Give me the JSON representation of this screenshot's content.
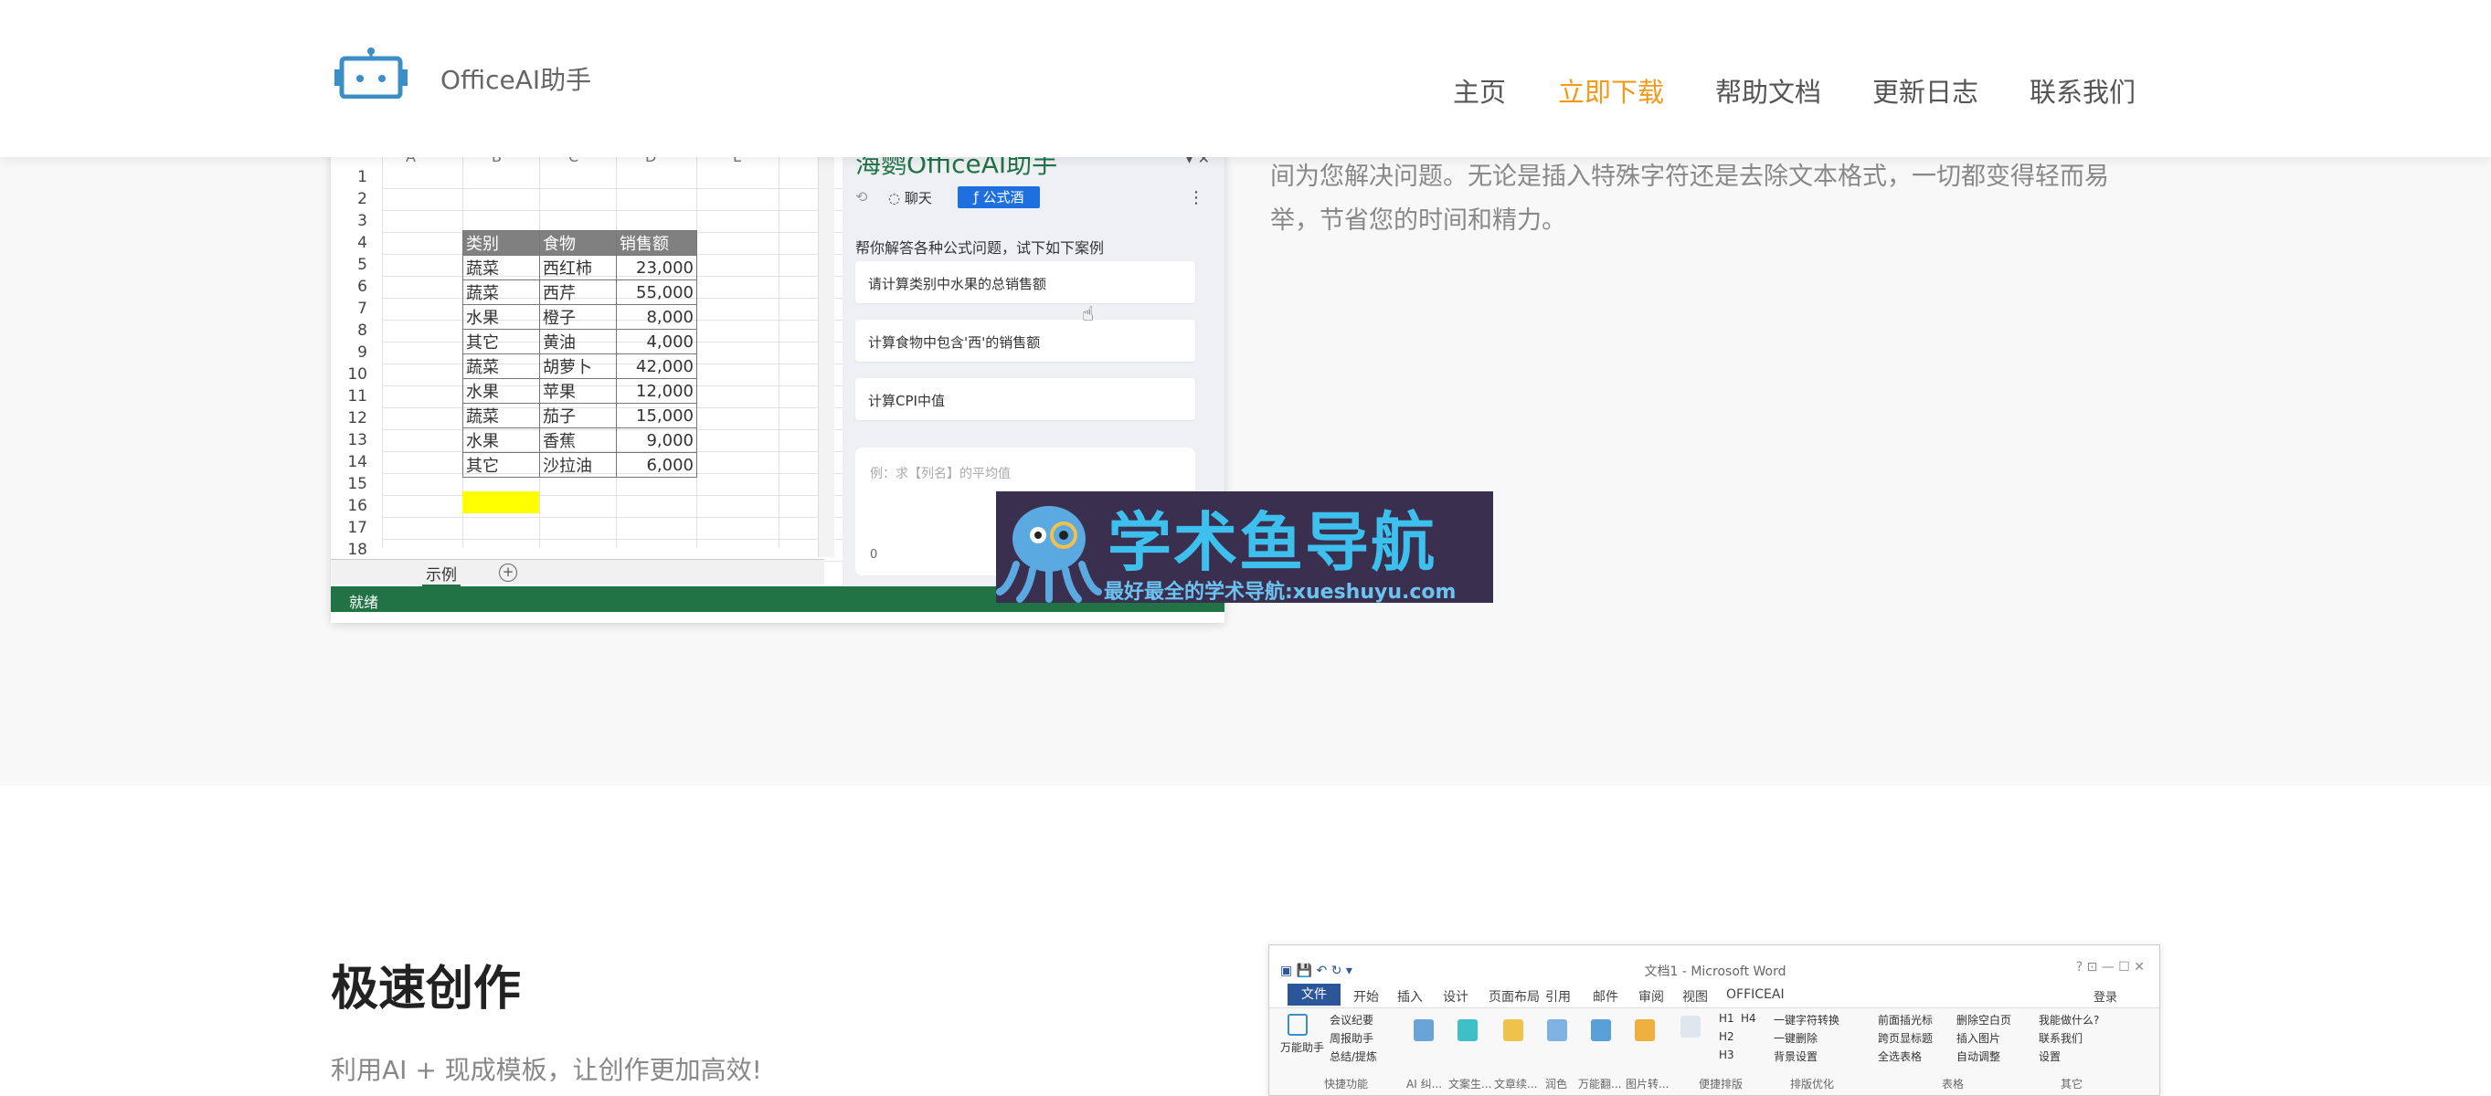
{
  "header": {
    "brand": "OfficeAI助手",
    "nav": [
      {
        "label": "主页"
      },
      {
        "label": "立即下载"
      },
      {
        "label": "帮助文档"
      },
      {
        "label": "更新日志"
      },
      {
        "label": "联系我们"
      }
    ],
    "active_color": "#f39a1a"
  },
  "hero": {
    "text": "间为您解决问题。无论是插入特殊字符还是去除文本格式，一切都变得轻而易举，节省您的时间和精力。"
  },
  "excel": {
    "columns": [
      "A",
      "B",
      "C",
      "D",
      "E"
    ],
    "rows": [
      "1",
      "2",
      "3",
      "4",
      "5",
      "6",
      "7",
      "8",
      "9",
      "10",
      "11",
      "12",
      "13",
      "14",
      "15",
      "16",
      "17",
      "18"
    ],
    "table_headers": [
      "类别",
      "食物",
      "销售额"
    ],
    "table_rows": [
      [
        "蔬菜",
        "西红柿",
        "23,000"
      ],
      [
        "蔬菜",
        "西芹",
        "55,000"
      ],
      [
        "水果",
        "橙子",
        "8,000"
      ],
      [
        "其它",
        "黄油",
        "4,000"
      ],
      [
        "蔬菜",
        "胡萝卜",
        "42,000"
      ],
      [
        "水果",
        "苹果",
        "12,000"
      ],
      [
        "蔬菜",
        "茄子",
        "15,000"
      ],
      [
        "水果",
        "香蕉",
        "9,000"
      ],
      [
        "其它",
        "沙拉油",
        "6,000"
      ]
    ],
    "sheet_tab": "示例",
    "status": "就绪",
    "status_color": "#217346"
  },
  "panel": {
    "title": "海鹦OfficeAI助手",
    "controls": "▾  ✕",
    "tab_chat": "聊天",
    "tab_formula": "公式酒",
    "hint": "帮你解答各种公式问题，试下如下案例",
    "cases": [
      "请计算类别中水果的总销售额",
      "计算食物中包含'西'的销售额",
      "计算CPI中值"
    ],
    "input_placeholder": "例：求【列名】的平均值",
    "input_count": "0",
    "accent": "#1e6fdf"
  },
  "watermark": {
    "title": "学术鱼导航",
    "subtitle": "最好最全的学术导航:xueshuyu.com"
  },
  "section2": {
    "title": "极速创作",
    "subtitle": "利用AI + 现成模板，让创作更加高效!"
  },
  "word": {
    "title": "文档1 - Microsoft Word",
    "window_controls": "?  ⊡  —  ☐  ✕",
    "file_tab": "文件",
    "tabs": [
      "开始",
      "插入",
      "设计",
      "页面布局",
      "引用",
      "邮件",
      "审阅",
      "视图",
      "OFFICEAI"
    ],
    "login": "登录",
    "ribbon_items": [
      "万能助手",
      "会议纪要",
      "周报助手",
      "总结/提炼",
      "一键字符转换",
      "一键删除",
      "背景设置",
      "前面插光标",
      "跨页显标题",
      "全选表格",
      "删除空白页",
      "插入图片",
      "自动调整",
      "我能做什么?",
      "联系我们",
      "设置",
      "H1",
      "H2",
      "H3",
      "H4"
    ],
    "groups": [
      "快捷功能",
      "AI 纠...",
      "文案生...",
      "文章续...",
      "润色",
      "万能翻...",
      "图片转...",
      "便捷排版",
      "排版优化",
      "表格",
      "其它"
    ]
  }
}
